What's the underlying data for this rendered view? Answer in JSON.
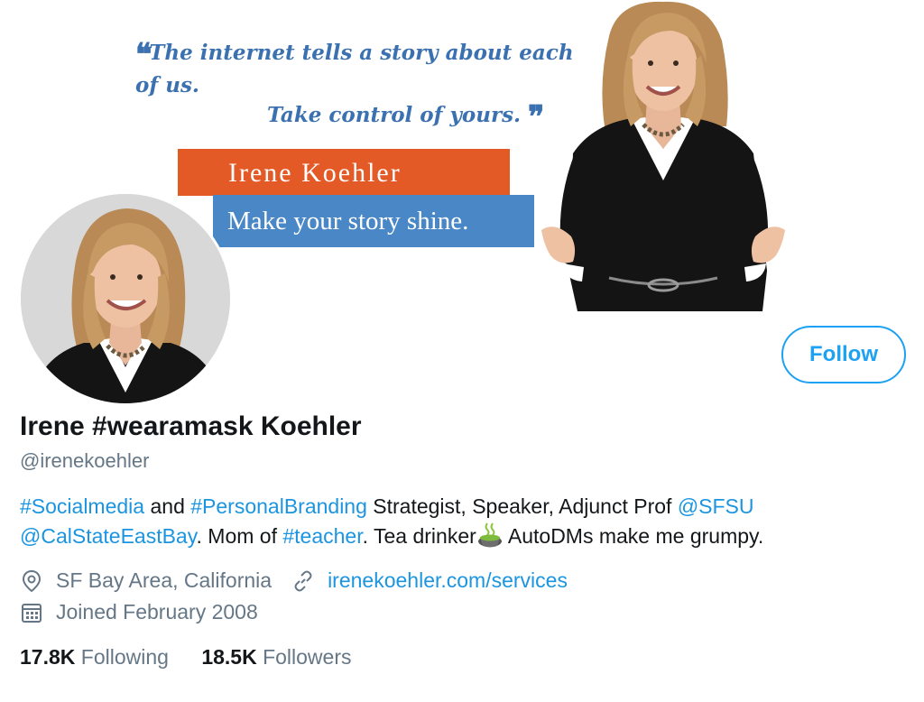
{
  "banner": {
    "quote_line1": "The internet tells a story about each of us.",
    "quote_line2": "Take control of yours.",
    "name_bar": "Irene Koehler",
    "tagline": "Make your story shine.",
    "colors": {
      "quote": "#3b71b0",
      "name_bar": "#e35a27",
      "tag_bar": "#4a87c6"
    }
  },
  "profile": {
    "display_name": "Irene #wearamask Koehler",
    "handle": "@irenekoehler",
    "follow_label": "Follow",
    "bio": {
      "hashtag_social": "#Socialmedia",
      "text_and": " and ",
      "hashtag_branding": "#PersonalBranding",
      "text_strategist": " Strategist, Speaker, Adjunct Prof ",
      "mention_sfsu": "@SFSU",
      "mention_calstate": "@CalStateEastBay",
      "text_mom": ". Mom of ",
      "hashtag_teacher": "#teacher",
      "text_tea": ". Tea drinker",
      "text_autodms": " AutoDMs make me grumpy."
    },
    "location": "SF Bay Area, California",
    "website": "irenekoehler.com/services",
    "joined": "Joined February 2008",
    "following_count": "17.8K",
    "following_label": "Following",
    "followers_count": "18.5K",
    "followers_label": "Followers"
  },
  "icons": {
    "location": "location-pin-icon",
    "link": "link-icon",
    "calendar": "calendar-icon",
    "tea": "tea-emoji-icon"
  },
  "accent_color": "#1da1f2"
}
